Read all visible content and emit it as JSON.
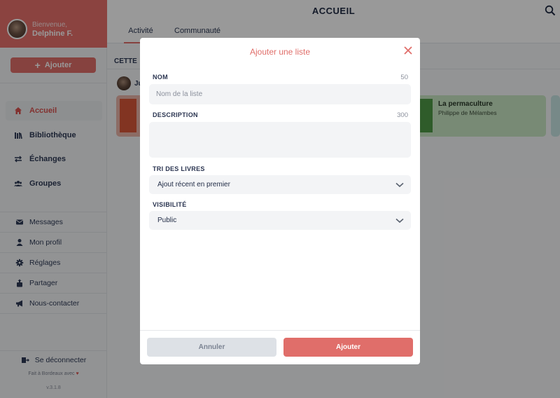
{
  "sidebar": {
    "welcome": "Bienvenue,",
    "user_name": "Delphine F.",
    "add_button": "Ajouter",
    "nav": [
      {
        "label": "Accueil",
        "icon": "home-icon"
      },
      {
        "label": "Bibliothèque",
        "icon": "library-icon"
      },
      {
        "label": "Échanges",
        "icon": "exchange-icon"
      },
      {
        "label": "Groupes",
        "icon": "groups-icon"
      }
    ],
    "secondary": [
      {
        "label": "Messages",
        "icon": "envelope-icon"
      },
      {
        "label": "Mon profil",
        "icon": "user-icon"
      },
      {
        "label": "Réglages",
        "icon": "gear-icon"
      },
      {
        "label": "Partager",
        "icon": "share-icon"
      },
      {
        "label": "Nous-contacter",
        "icon": "megaphone-icon"
      }
    ],
    "logout": "Se déconnecter",
    "made_with": "Fait à Bordeaux avec",
    "version": "v.3.1.8"
  },
  "header": {
    "title": "ACCUEIL",
    "tabs": [
      "Activité",
      "Communauté"
    ]
  },
  "feed": {
    "section_label": "CETTE",
    "user_initial": "Ju",
    "book": {
      "title": "La permaculture",
      "author": "Philippe de Mélambes"
    }
  },
  "modal": {
    "title": "Ajouter une liste",
    "name_label": "NOM",
    "name_max": "50",
    "name_placeholder": "Nom de la liste",
    "name_value": "",
    "description_label": "DESCRIPTION",
    "description_max": "300",
    "description_value": "",
    "sort_label": "TRI DES LIVRES",
    "sort_value": "Ajout récent en premier",
    "visibility_label": "VISIBILITÉ",
    "visibility_value": "Public",
    "cancel": "Annuler",
    "submit": "Ajouter"
  },
  "colors": {
    "accent": "#e06e6a",
    "profile_bg": "#e8706c",
    "book_card": "#c9e6c3"
  }
}
